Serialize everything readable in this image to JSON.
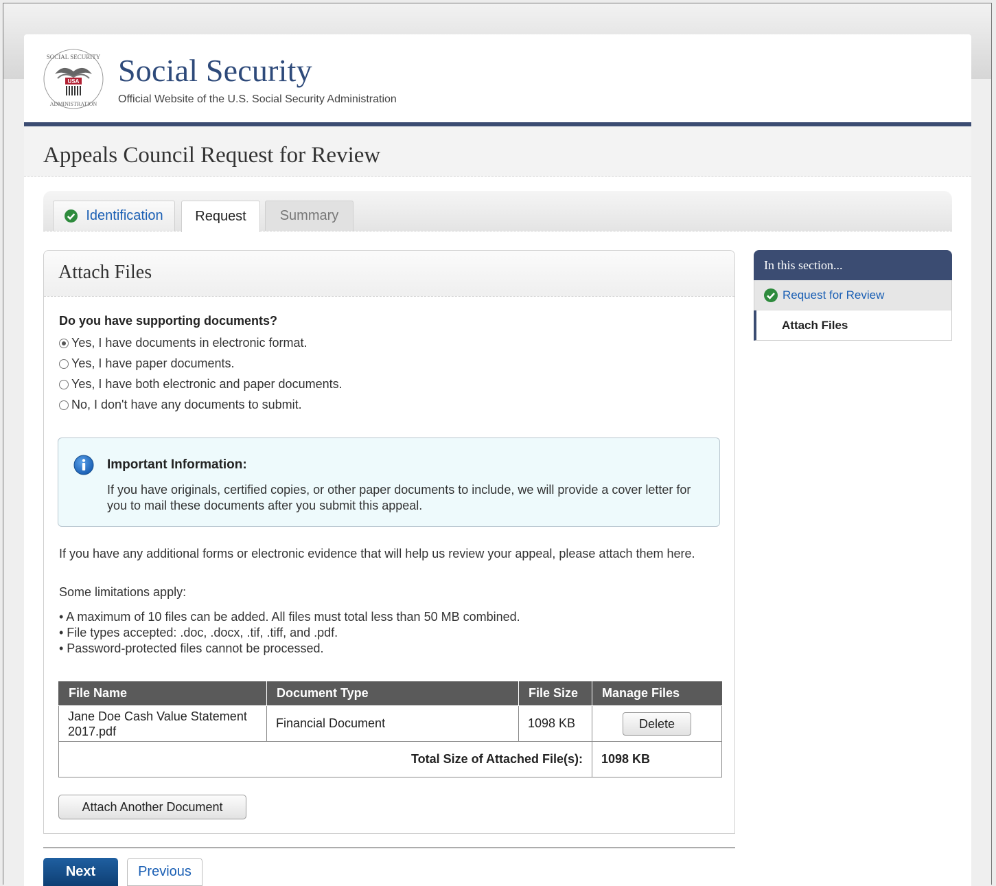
{
  "header": {
    "site_title": "Social Security",
    "site_subtitle": "Official Website of the U.S. Social Security Administration",
    "seal_text": "SOCIAL SECURITY ADMINISTRATION USA"
  },
  "page_title": "Appeals Council Request for Review",
  "tabs": [
    {
      "label": "Identification",
      "state": "completed"
    },
    {
      "label": "Request",
      "state": "active"
    },
    {
      "label": "Summary",
      "state": "disabled"
    }
  ],
  "panel": {
    "title": "Attach Files",
    "question": "Do you have supporting documents?",
    "options": [
      {
        "label": "Yes, I have documents in electronic format.",
        "selected": true
      },
      {
        "label": "Yes, I have paper documents.",
        "selected": false
      },
      {
        "label": "Yes, I have both electronic and paper documents.",
        "selected": false
      },
      {
        "label": "No, I don't have any documents to submit.",
        "selected": false
      }
    ],
    "info": {
      "title": "Important Information:",
      "text": "If you have originals, certified copies, or other paper documents to include, we will provide a cover letter for you to mail these documents after you submit this appeal."
    },
    "intro": "If you have any additional forms or electronic evidence that will help us review your appeal, please attach them here.",
    "limitations_label": "Some limitations apply:",
    "limitations": [
      "• A maximum of 10 files can be added. All files must total less than 50 MB combined.",
      "• File types accepted: .doc, .docx, .tif, .tiff, and .pdf.",
      "• Password-protected files cannot be processed."
    ],
    "table": {
      "headers": [
        "File Name",
        "Document Type",
        "File Size",
        "Manage Files"
      ],
      "rows": [
        {
          "file_name": "Jane Doe Cash Value Statement 2017.pdf",
          "doc_type": "Financial Document",
          "size": "1098 KB",
          "action": "Delete"
        }
      ],
      "total_label": "Total Size of Attached File(s):",
      "total_value": "1098 KB"
    },
    "attach_button": "Attach Another Document"
  },
  "nav": {
    "next": "Next",
    "previous": "Previous"
  },
  "sidebar": {
    "title": "In this section...",
    "items": [
      {
        "label": "Request for Review",
        "state": "completed"
      },
      {
        "label": "Attach Files",
        "state": "current"
      }
    ]
  },
  "colors": {
    "brand_navy": "#3b4c72",
    "link_blue": "#1a5fb4",
    "check_green": "#2e8b3d",
    "info_bg": "#eefafc",
    "table_header": "#5a5a5a"
  }
}
